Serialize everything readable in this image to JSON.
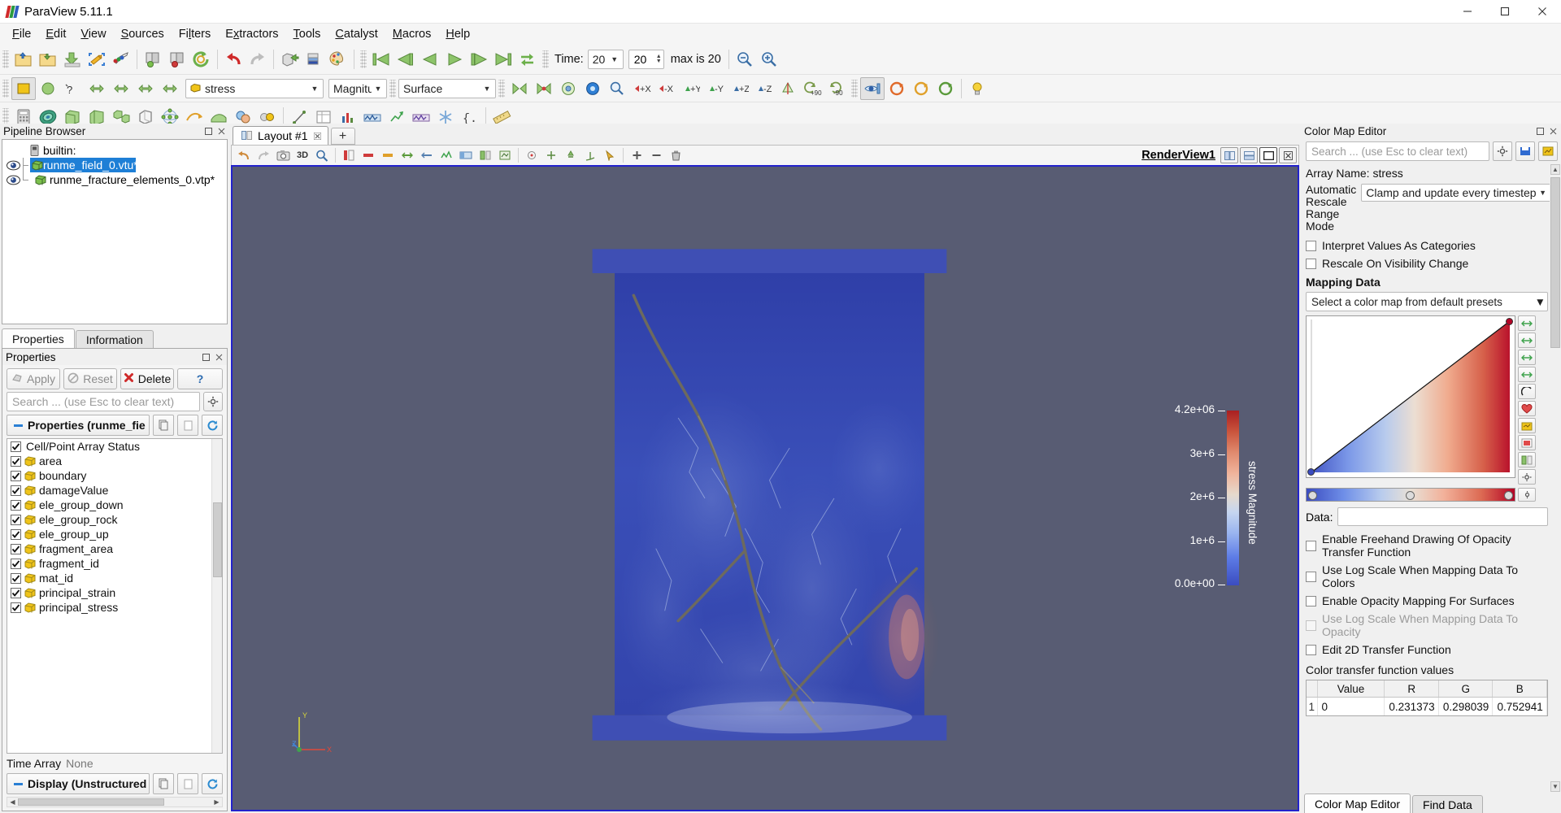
{
  "window": {
    "title": "ParaView 5.11.1",
    "minimize": "minimize-icon",
    "maximize": "maximize-icon",
    "close": "close-icon"
  },
  "menu": {
    "items": [
      "File",
      "Edit",
      "View",
      "Sources",
      "Filters",
      "Extractors",
      "Tools",
      "Catalyst",
      "Macros",
      "Help"
    ]
  },
  "toolbar_main": {
    "icons": [
      "open-file",
      "open-recent",
      "save-data",
      "save-screenshot",
      "save-state",
      "connect-server",
      "disconnect-server",
      "reset-session",
      "undo",
      "redo",
      "camera-undo",
      "camera-redo",
      "edit-color-map"
    ],
    "time_label": "Time:",
    "time_value": "20",
    "frame_value": "20",
    "max_label": "max is 20",
    "vcr": [
      "first-frame",
      "previous-frame",
      "play-reverse",
      "play",
      "next-frame",
      "last-frame",
      "loop"
    ]
  },
  "toolbar_repr": {
    "array_selector": "stress",
    "component_selector": "Magnitu",
    "representation_selector": "Surface",
    "camera_buttons": [
      "+X",
      "-X",
      "+Y",
      "-Y",
      "+Z",
      "-Z"
    ],
    "rotate_labels": [
      "+90",
      "-90"
    ]
  },
  "pipeline": {
    "title": "Pipeline Browser",
    "items": [
      {
        "label": "builtin:",
        "type": "server",
        "selected": false,
        "eye": false,
        "indent": 0
      },
      {
        "label": "runme_field_0.vtu*",
        "type": "source",
        "selected": true,
        "eye": true,
        "indent": 1
      },
      {
        "label": "runme_fracture_elements_0.vtp*",
        "type": "source",
        "selected": false,
        "eye": true,
        "indent": 1
      }
    ]
  },
  "properties": {
    "tabs": [
      {
        "label": "Properties",
        "selected": true
      },
      {
        "label": "Information",
        "selected": false
      }
    ],
    "panel_title": "Properties",
    "buttons": {
      "apply": "Apply",
      "reset": "Reset",
      "delete": "Delete",
      "help": "?"
    },
    "search_placeholder": "Search ... (use Esc to clear text)",
    "section_title": "Properties (runme_fie",
    "array_status_label": "Cell/Point Array Status",
    "arrays": [
      "area",
      "boundary",
      "damageValue",
      "ele_group_down",
      "ele_group_rock",
      "ele_group_up",
      "fragment_area",
      "fragment_id",
      "mat_id",
      "principal_strain",
      "principal_stress"
    ],
    "time_array_label": "Time Array",
    "time_array_value": "None",
    "display_section": "Display (Unstructured"
  },
  "layout": {
    "tab_label": "Layout #1",
    "add_tab": "+",
    "view_name": "RenderView1",
    "view_toolbar_icons": [
      "undo-camera",
      "redo-camera",
      "capture-screenshot",
      "3d",
      "zoom-to-box",
      "reset-camera",
      "zoom-closest",
      "adjust-camera",
      "show-center",
      "pick-center",
      "reset-center",
      "show-color-legend",
      "edit-color-map",
      "rescale-data-range",
      "rescale-custom",
      "rescale-visible",
      "rescale-temporal",
      "choose-preset",
      "link-color-map",
      "add-separator",
      "remove-separator",
      "delete-view"
    ],
    "split_horizontal": "split-horizontal-icon",
    "split_vertical": "split-vertical-icon",
    "maximize_view": "maximize-view-icon",
    "close_view": "close-view-icon"
  },
  "render_view": {
    "background": "#585c73",
    "scalar_bar": {
      "title": "stress Magnitude",
      "ticks": [
        "4.2e+06",
        "3e+6",
        "2e+6",
        "1e+6",
        "0.0e+00"
      ]
    },
    "axes": {
      "x": "X",
      "y": "Y",
      "z": "Z"
    }
  },
  "color_map_editor": {
    "title": "Color Map Editor",
    "search_placeholder": "Search ... (use Esc to clear text)",
    "toolbar_icons": [
      "gear-icon",
      "save-default-icon",
      "advanced-icon"
    ],
    "array_name_label": "Array Name: stress",
    "auto_rescale_label": "Automatic Rescale Range Mode",
    "auto_rescale_value": "Clamp and update every timestep",
    "checkboxes": [
      {
        "label": "Interpret Values As Categories",
        "checked": false,
        "disabled": false
      },
      {
        "label": "Rescale On Visibility Change",
        "checked": false,
        "disabled": false
      }
    ],
    "mapping_data_label": "Mapping Data",
    "preset_placeholder": "Select a color map from default presets",
    "side_buttons": [
      "rescale-range",
      "rescale-custom-range",
      "rescale-visible-data",
      "rescale-over-time",
      "invert-transfer-function",
      "choose-preset",
      "save-preset",
      "edit-color-legend",
      "color-legend-visibility",
      "advanced-settings"
    ],
    "data_label": "Data:",
    "data_value": "",
    "options": [
      {
        "label": "Enable Freehand Drawing Of Opacity Transfer Function",
        "checked": false,
        "disabled": false
      },
      {
        "label": "Use Log Scale When Mapping Data To Colors",
        "checked": false,
        "disabled": false
      },
      {
        "label": "Enable Opacity Mapping For Surfaces",
        "checked": false,
        "disabled": false
      },
      {
        "label": "Use Log Scale When Mapping Data To Opacity",
        "checked": false,
        "disabled": true
      },
      {
        "label": "Edit 2D Transfer Function",
        "checked": false,
        "disabled": false
      }
    ],
    "ctf_title": "Color transfer function values",
    "ctf_headers": [
      "Value",
      "R",
      "G",
      "B"
    ],
    "ctf_rows": [
      {
        "index": "1",
        "value": "0",
        "r": "0.231373",
        "g": "0.298039",
        "b": "0.752941"
      }
    ],
    "tabs": [
      {
        "label": "Color Map Editor",
        "selected": true
      },
      {
        "label": "Find Data",
        "selected": false
      }
    ]
  },
  "colors": {
    "accent": "#1e7fd6",
    "view_border": "#2222cc",
    "render_bg": "#585c73",
    "cmap_low": "#3b4cc0",
    "cmap_high": "#b40426",
    "toolbar_bg": "#f5f5f5"
  }
}
